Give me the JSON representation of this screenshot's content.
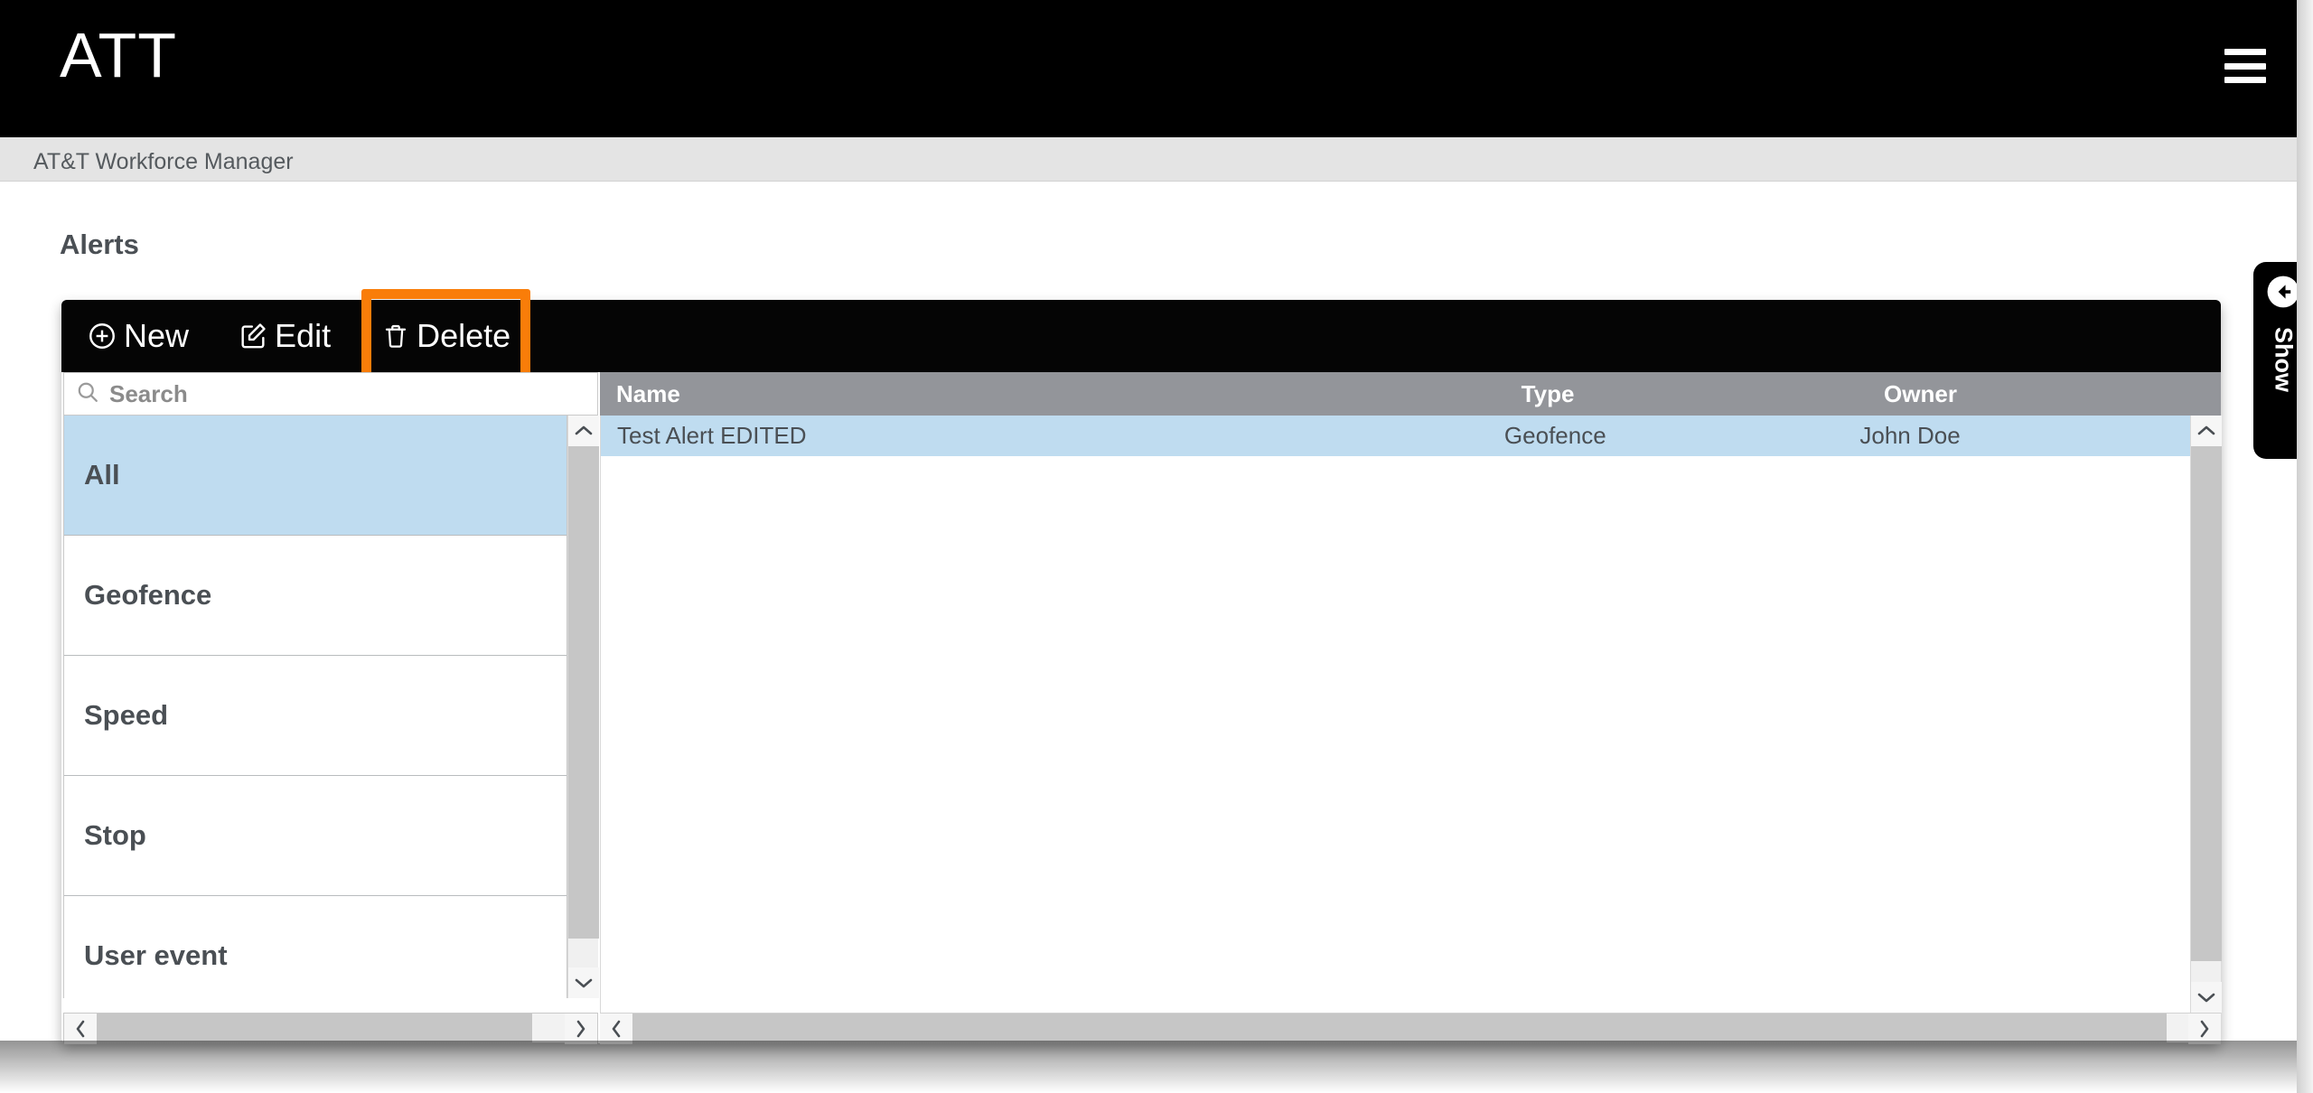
{
  "header": {
    "brand": "ATT",
    "menu_icon": "hamburger-icon"
  },
  "breadcrumb": {
    "text": "AT&T Workforce Manager"
  },
  "page": {
    "title": "Alerts"
  },
  "toolbar": {
    "new_label": "New",
    "edit_label": "Edit",
    "delete_label": "Delete",
    "highlight_color": "#F97D09",
    "background_color": "#050505"
  },
  "search": {
    "placeholder": "Search",
    "value": ""
  },
  "categories": {
    "selected": "All",
    "items": [
      {
        "label": "All",
        "selected": true
      },
      {
        "label": "Geofence",
        "selected": false
      },
      {
        "label": "Speed",
        "selected": false
      },
      {
        "label": "Stop",
        "selected": false
      },
      {
        "label": "User event",
        "selected": false
      }
    ]
  },
  "grid": {
    "columns": [
      "Name",
      "Type",
      "Owner"
    ],
    "rows": [
      {
        "name": "Test Alert EDITED",
        "type": "Geofence",
        "owner": "John Doe",
        "selected": true
      }
    ],
    "header_background": "#93959a",
    "selected_row_color": "#bfdcf0"
  },
  "side_tab": {
    "label": "Show",
    "icon": "arrow-left-circle-icon"
  },
  "scrollbars": {
    "left_up": "⌃",
    "left_down": "⌄",
    "arrow_left": "‹",
    "arrow_right": "›"
  }
}
